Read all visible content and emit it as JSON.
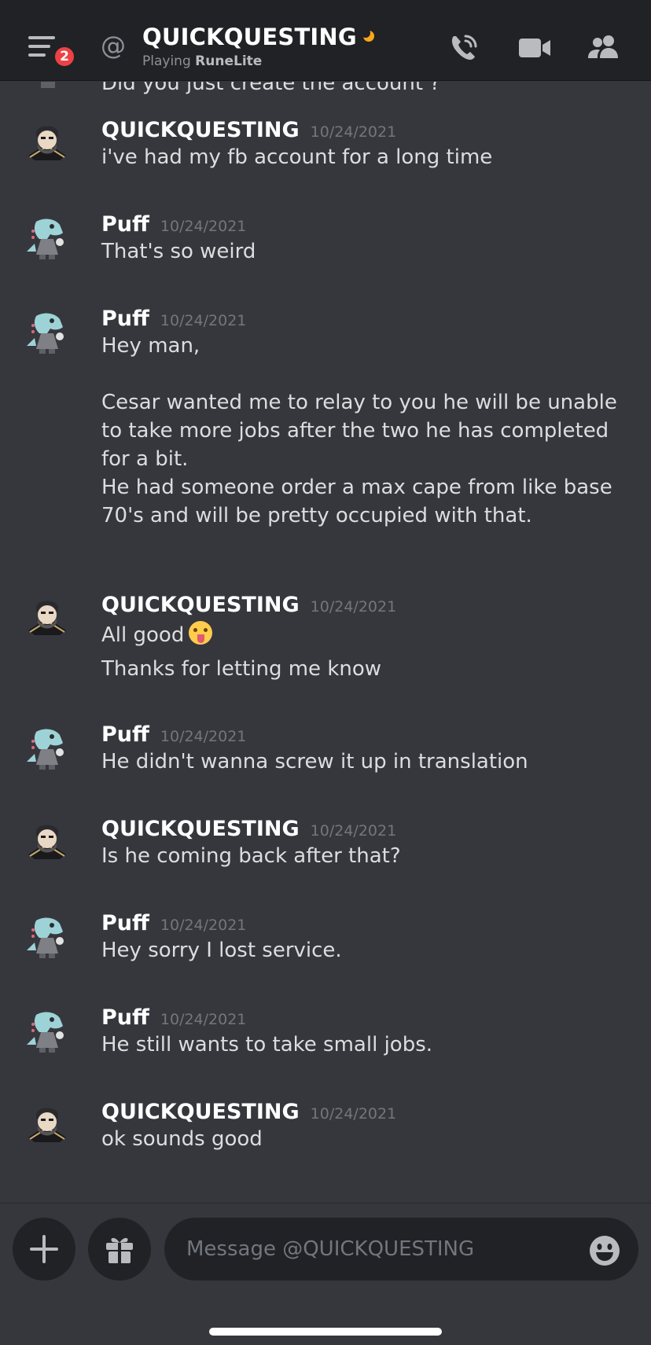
{
  "header": {
    "unread_badge": "2",
    "at_symbol": "@",
    "title": "QUICKQUESTING",
    "status_color": "#faa61a",
    "subtitle_prefix": "Playing",
    "subtitle_game": "RuneLite",
    "icons": [
      "menu-icon",
      "at-icon",
      "call-icon",
      "video-icon",
      "members-icon"
    ]
  },
  "messages": {
    "partial_top_line": "Did you just create the account ?",
    "items": [
      {
        "author": "QUICKQUESTING",
        "timestamp": "10/24/2021",
        "lines": [
          "i've had my fb account for a long time"
        ]
      },
      {
        "author": "Puff",
        "timestamp": "10/24/2021",
        "lines": [
          "That's so weird"
        ]
      },
      {
        "author": "Puff",
        "timestamp": "10/24/2021",
        "lines": [
          "Hey man,\n\nCesar wanted me to relay to you he will be unable to take more jobs after the two he has completed for a bit.\nHe had someone order a max cape from like base 70's and will be pretty occupied with that."
        ]
      },
      {
        "author": "QUICKQUESTING",
        "timestamp": "10/24/2021",
        "lines": [
          "All good",
          "Thanks for letting me know"
        ]
      },
      {
        "author": "Puff",
        "timestamp": "10/24/2021",
        "lines": [
          "He didn't wanna screw it up in translation"
        ]
      },
      {
        "author": "QUICKQUESTING",
        "timestamp": "10/24/2021",
        "lines": [
          "Is he coming back after that?"
        ]
      },
      {
        "author": "Puff",
        "timestamp": "10/24/2021",
        "lines": [
          "Hey sorry I lost service."
        ]
      },
      {
        "author": "Puff",
        "timestamp": "10/24/2021",
        "lines": [
          "He still wants to take small jobs."
        ]
      },
      {
        "author": "QUICKQUESTING",
        "timestamp": "10/24/2021",
        "lines": [
          "ok sounds good"
        ]
      }
    ]
  },
  "composer": {
    "placeholder": "Message @QUICKQUESTING",
    "icons": [
      "plus-icon",
      "gift-icon",
      "emoji-icon"
    ]
  },
  "colors": {
    "background": "#36373d",
    "header_bg": "#202225",
    "badge": "#ed4245",
    "username": "#ffffff",
    "timestamp": "#72767d"
  }
}
